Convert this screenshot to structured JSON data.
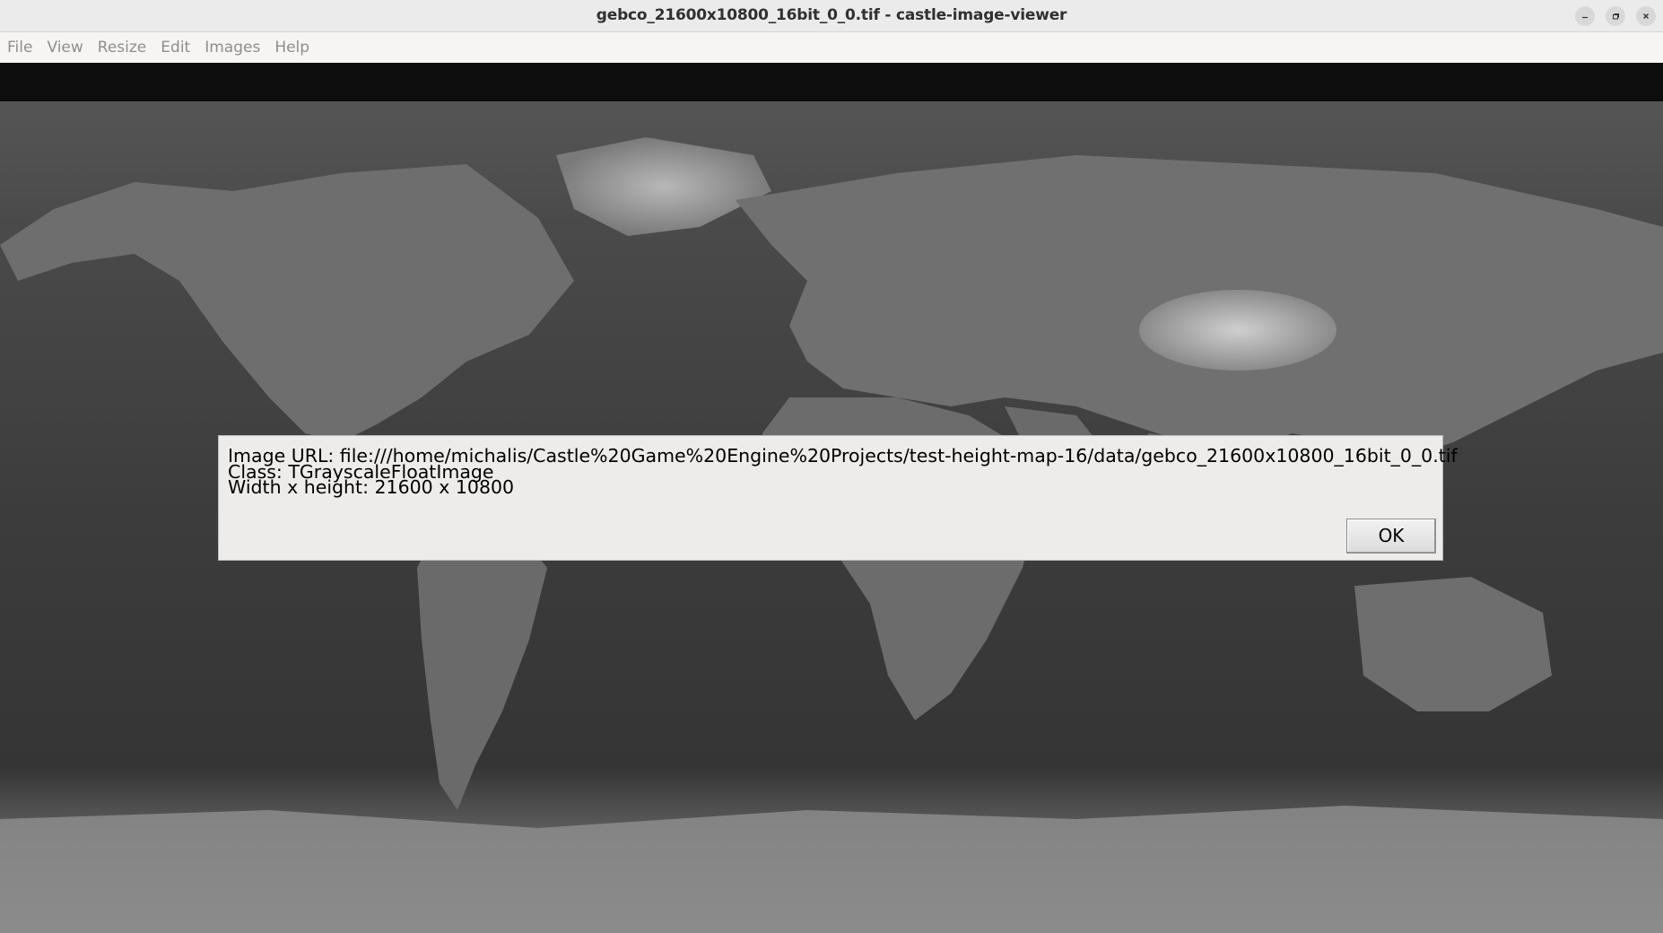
{
  "window": {
    "title": "gebco_21600x10800_16bit_0_0.tif - castle-image-viewer"
  },
  "menu": {
    "items": [
      "File",
      "View",
      "Resize",
      "Edit",
      "Images",
      "Help"
    ]
  },
  "dialog": {
    "image_url_line": "Image URL: file:///home/michalis/Castle%20Game%20Engine%20Projects/test-height-map-16/data/gebco_21600x10800_16bit_0_0.tif",
    "class_line": "Class: TGrayscaleFloatImage",
    "size_line": "Width x height: 21600 x 10800",
    "ok_label": "OK"
  },
  "icons": {
    "minimize": "minimize-icon",
    "maximize": "maximize-icon",
    "close": "close-icon"
  },
  "colors": {
    "titlebar_bg": "#ebebeb",
    "menubar_bg": "#f6f5f4",
    "dialog_bg": "#edecea",
    "map_ocean": "#3a3a3a",
    "map_land": "#7a7a7a"
  }
}
